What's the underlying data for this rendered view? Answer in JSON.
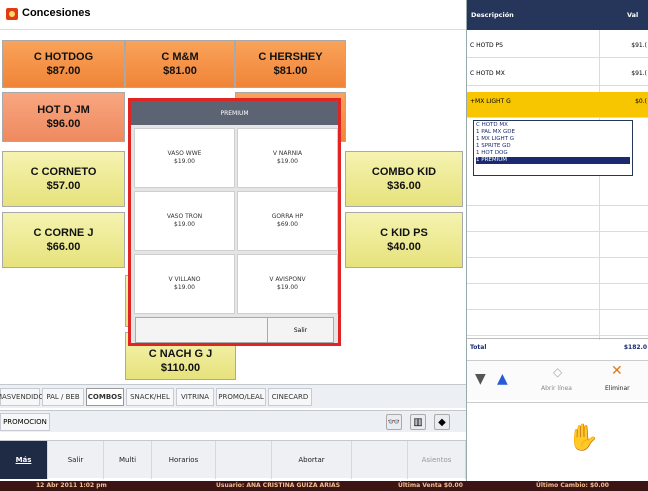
{
  "app": {
    "title": "Concesiones"
  },
  "products": [
    {
      "name": "C HOTDOG",
      "price": "$87.00"
    },
    {
      "name": "C M&M",
      "price": "$81.00"
    },
    {
      "name": "C HERSHEY",
      "price": "$81.00"
    },
    {
      "name": "HOT D JM",
      "price": "$96.00"
    },
    {
      "name": "C CORNETO",
      "price": "$57.00"
    },
    {
      "name": "COMBO KID",
      "price": "$36.00"
    },
    {
      "name": "C CORNE J",
      "price": "$66.00"
    },
    {
      "name": "C KID PS",
      "price": "$40.00"
    },
    {
      "name": "C NACH G J",
      "price": "$110.00"
    }
  ],
  "categories": [
    "MASVENDIDO",
    "PAL / BEB",
    "COMBOS",
    "SNACK/HEL",
    "VITRINA",
    "PROMO/LEAL",
    "CINECARD"
  ],
  "promo_label": "PROMOCION",
  "actions": {
    "mas": "Más",
    "salir": "Salir",
    "multi": "Multi",
    "horarios": "Horarios",
    "abortar": "Abortar",
    "asientos": "Asientos"
  },
  "premium": {
    "title": "PREMIUM",
    "items": [
      {
        "name": "VASO WWE",
        "price": "$19.00"
      },
      {
        "name": "V NARNIA",
        "price": "$19.00"
      },
      {
        "name": "VASO TRON",
        "price": "$19.00"
      },
      {
        "name": "GORRA HP",
        "price": "$69.00"
      },
      {
        "name": "V VILLANO",
        "price": "$19.00"
      },
      {
        "name": "V AVISPONV",
        "price": "$19.00"
      }
    ],
    "close_label": "Salir"
  },
  "order": {
    "header_desc": "Descripción",
    "header_val": "Val",
    "rows": [
      {
        "desc": "C HOTD PS",
        "val": "$91.("
      },
      {
        "desc": "C HOTD MX",
        "val": "$91.("
      },
      {
        "desc": "+MX LIGHT G",
        "val": "$0.("
      }
    ],
    "modifiers": [
      "C HOTD MX",
      "1    PAL MX GDE",
      "1      MX LIGHT G",
      "1    SPRITE GD",
      "1    HOT DOG",
      "1    PREMIUM"
    ],
    "total_label": "Total",
    "total_value": "$182.0",
    "abrir_label": "Abrir línea",
    "eliminar_label": "Eliminar"
  },
  "status": {
    "datetime": "12 Abr 2011 1:02 pm",
    "user": "Usuario: ANA CRISTINA GUIZA ARIAS",
    "last_sale": "Última Venta $0.00",
    "last_change": "Último Cambio: $0.00"
  },
  "colors": {
    "accent_red": "#e02424",
    "header_navy": "#26365a",
    "selected_row": "#f7c600",
    "orange_button": "#f08438",
    "yellow_button": "#e6e27c"
  }
}
